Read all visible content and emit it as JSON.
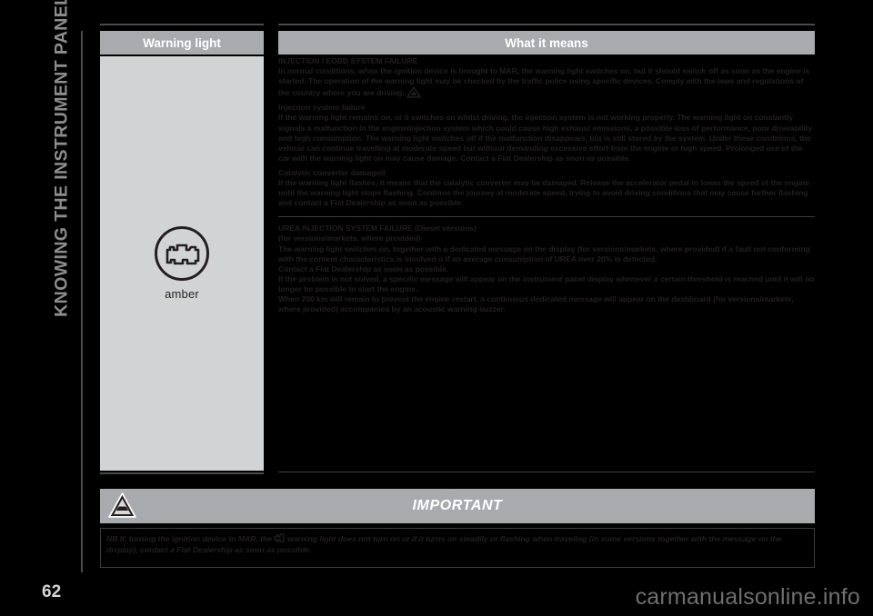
{
  "chapter": {
    "title": "KNOWING THE INSTRUMENT PANEL",
    "page_number": "62"
  },
  "table": {
    "headers": {
      "warning_light": "Warning light",
      "what_it_means": "What it means"
    },
    "warning_light_cell": {
      "icon_name": "engine-check-icon",
      "color_label": "amber"
    }
  },
  "content": {
    "block1": {
      "title": "INJECTION / EOBD SYSTEM FAILURE",
      "para1_before_icon": "In normal conditions, when the ignition device is brought to MAR, the warning light switches on, but it should switch off as soon as the engine is started. The operation of the warning light may be checked by the traffic police using specific devices. Comply with the laws and regulations of the country where you are driving.",
      "para1_after_icon": "",
      "sub1": "Injection system failure",
      "para2": "If the warning light remains on, or it switches on whilst driving, the injection system is not working properly. The warning light on constantly signals a malfunction in the engine/injection system which could cause high exhaust emissions, a possible loss of performance, poor driveability and high consumption. The warning light switches off if the malfunction disappears, but is still stored by the system. Under these conditions, the vehicle can continue travelling at moderate speed but without demanding excessive effort from the engine or high speed. Prolonged use of the car with the warning light on may cause damage. Contact a Fiat Dealership as soon as possible.",
      "sub2": "Catalytic converter damaged",
      "para3": "If the warning light flashes, it means that the catalytic converter may be damaged. Release the accelerator pedal to lower the speed of the engine until the warning light stops flashing. Continue the journey at moderate speed, trying to avoid driving conditions that may cause further flashing and contact a Fiat Dealership as soon as possible."
    },
    "block2": {
      "title": "UREA INJECTION SYSTEM FAILURE (Diesel versions)",
      "subtitle": "(for versions/markets, where provided)",
      "para1": "The warning light switches on, together with a dedicated message on the display (for versions/markets, where provided) if a fault not conforming with the content characteristics is involved o if an average consumption of UREA over 20% is detected.",
      "para2": "Contact a Fiat Dealership as soon as possible.",
      "para3": "If the problem is not solved, a specific message will appear on the instrument panel display whenever a certain threshold is reached until it will no longer be possible to start the engine.",
      "para4": "When 200 km will remain to prevent the engine restart, a continuous dedicated message will appear on the dashboard (for versions/markets, where provided) accompanied by an acoustic warning buzzer."
    }
  },
  "important": {
    "banner_label": "IMPORTANT",
    "icon_name": "warning-triangle-car-icon",
    "note_before_lamp": "NB If, turning the ignition device to MAR, the",
    "note_after_lamp": "warning light does not turn on or if it turns on steadily or flashing when traveling (in some versions together with the message on the display), contact a Fiat Dealership as soon as possible."
  },
  "watermark": {
    "text": "carmanualsonline.info"
  },
  "colors": {
    "page_background": "#000000",
    "header_band": "#a8aaad",
    "icon_cell": "#d2d3d5",
    "rail_text": "#8d8d8d",
    "body_text": "#231f20"
  }
}
